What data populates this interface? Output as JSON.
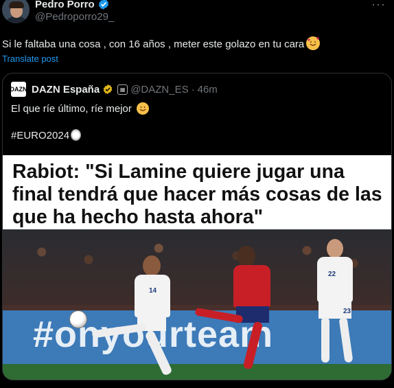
{
  "author": {
    "name": "Pedro Porro",
    "handle": "@Pedroporro29_"
  },
  "tweet": {
    "text": "Si le faltaba una cosa , con 16 años , meter este golazo en tu cara",
    "translate_label": "Translate post"
  },
  "quote": {
    "logo_text": "DAZN",
    "name": "DAZN España",
    "handle": "@DAZN_ES",
    "separator": "·",
    "time": "46m",
    "line1": "El que ríe último, ríe mejor",
    "line2": "#EURO2024",
    "headline": "Rabiot: \"Si Lamine quiere jugar una final tendrá que hacer más cosas de las que ha hecho hasta ahora\"",
    "board_text": "#onyourteam",
    "shirt_numbers": [
      "14",
      "22",
      "23"
    ]
  },
  "icons": {
    "verified": "blue-verified-badge",
    "gold": "gold-verified-badge",
    "more": "more-dots-icon",
    "emoji_smile_hearts": "smiling-face-with-hearts",
    "emoji_smile": "smiling-face",
    "emoji_ball": "soccer-ball"
  },
  "colors": {
    "background": "#000000",
    "link": "#1d9bf0",
    "muted": "#71767b",
    "text": "#e7e9ea",
    "border": "#2f3336"
  }
}
